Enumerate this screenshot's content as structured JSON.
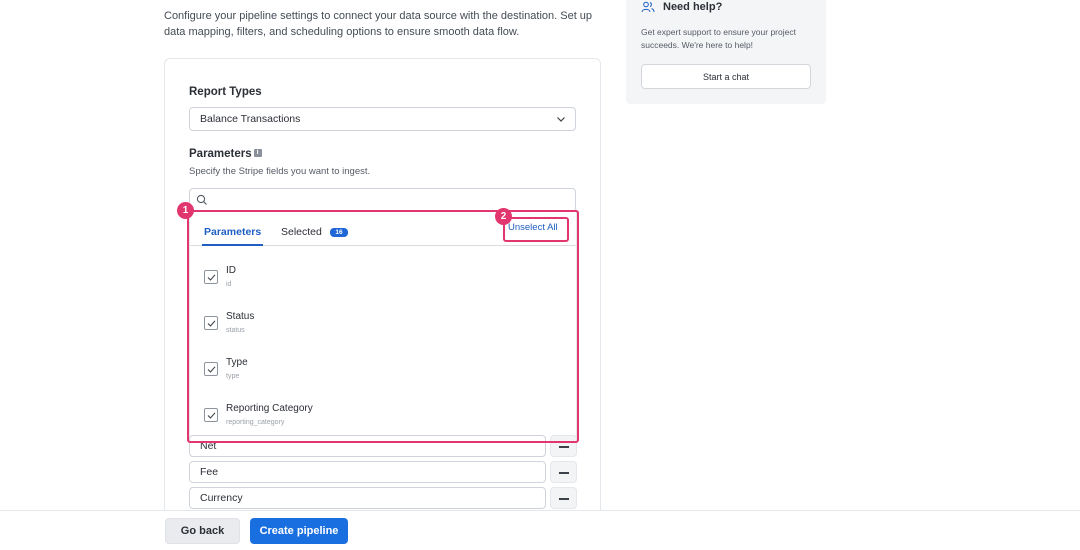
{
  "header": {
    "description": "Configure your pipeline settings to connect your data source with the destination. Set up data mapping, filters, and scheduling options to ensure smooth data flow."
  },
  "form": {
    "report_types_label": "Report Types",
    "report_type_value": "Balance Transactions",
    "parameters_label": "Parameters",
    "parameters_hint": "Specify the Stripe fields you want to ingest.",
    "search_placeholder": ""
  },
  "dropdown": {
    "tabs": [
      {
        "label": "Parameters",
        "active": true
      },
      {
        "label": "Selected",
        "count": "16"
      }
    ],
    "unselect_all": "Unselect All",
    "items": [
      {
        "label": "ID",
        "key": "id",
        "checked": true
      },
      {
        "label": "Status",
        "key": "status",
        "checked": true
      },
      {
        "label": "Type",
        "key": "type",
        "checked": true
      },
      {
        "label": "Reporting Category",
        "key": "reporting_category",
        "checked": true
      }
    ]
  },
  "selected_fields": [
    "Net",
    "Fee",
    "Currency"
  ],
  "annotations": [
    "1",
    "2"
  ],
  "footer": {
    "back_label": "Go back",
    "create_label": "Create pipeline"
  },
  "help": {
    "icon": "users-icon",
    "title": "Need help?",
    "text": "Get expert support to ensure your project succeeds. We're here to help!",
    "button": "Start a chat"
  },
  "colors": {
    "accent": "#1a6fe0",
    "highlight": "#e2366e"
  }
}
